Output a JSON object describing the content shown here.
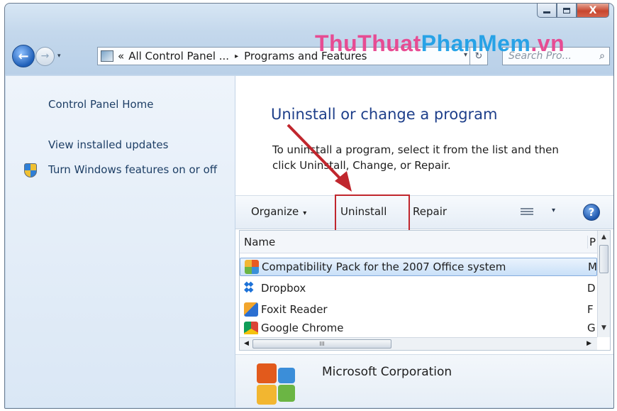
{
  "window": {
    "caption": {
      "minimize_icon": "minimize-icon",
      "maximize_icon": "maximize-icon",
      "close_symbol": "X"
    }
  },
  "nav": {
    "back_symbol": "←",
    "forward_symbol": "→",
    "history_symbol": "▾",
    "address": {
      "chevron": "«",
      "crumb1": "All Control Panel ...",
      "separator": "▸",
      "crumb2": "Programs and Features",
      "dropdown": "▾"
    },
    "refresh_symbol": "↻",
    "search_placeholder": "Search Pro...",
    "search_symbol": "⌕"
  },
  "watermark": {
    "part1": "ThuThuat",
    "part2": "PhanMem",
    "part3": ".vn"
  },
  "sidebar": {
    "links": [
      "Control Panel Home",
      "View installed updates",
      "Turn Windows features on or off"
    ]
  },
  "main": {
    "heading": "Uninstall or change a program",
    "description": "To uninstall a program, select it from the list and then click Uninstall, Change, or Repair."
  },
  "toolbar": {
    "organize": "Organize",
    "organize_dd": "▾",
    "uninstall": "Uninstall",
    "repair": "Repair",
    "view_dd": "▾",
    "help": "?"
  },
  "list": {
    "columns": {
      "name": "Name",
      "publisher": "P"
    },
    "rows": [
      {
        "name": "Compatibility Pack for the 2007 Office system",
        "pub": "M"
      },
      {
        "name": "Dropbox",
        "pub": "D"
      },
      {
        "name": "Foxit Reader",
        "pub": "F"
      },
      {
        "name": "Google Chrome",
        "pub": "G"
      }
    ],
    "scroll": {
      "up": "▲",
      "down": "▼",
      "left": "◀",
      "right": "▶",
      "grip": "III"
    }
  },
  "details": {
    "publisher": "Microsoft Corporation"
  },
  "colors": {
    "accent_red": "#c0262d",
    "link_blue": "#1e3f66",
    "heading_blue": "#1e3f8a"
  }
}
